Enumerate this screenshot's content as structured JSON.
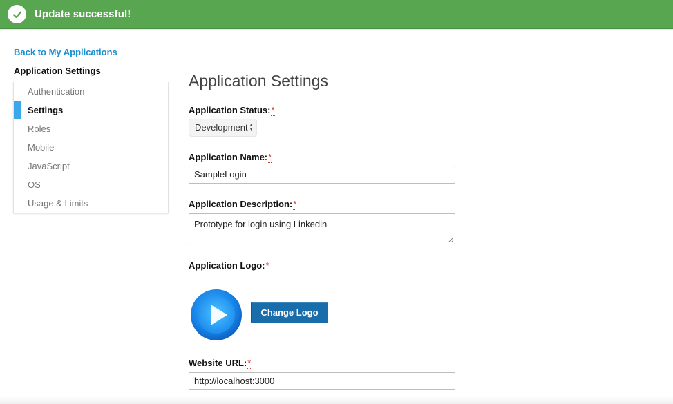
{
  "banner": {
    "message": "Update successful!",
    "icon": "check-icon",
    "color": "#58a650"
  },
  "sidebar": {
    "back_link": "Back to My Applications",
    "title": "Application Settings",
    "active_color": "#3ba9e8",
    "items": [
      {
        "label": "Authentication"
      },
      {
        "label": "Settings",
        "active": true
      },
      {
        "label": "Roles"
      },
      {
        "label": "Mobile"
      },
      {
        "label": "JavaScript"
      },
      {
        "label": "OS"
      },
      {
        "label": "Usage & Limits"
      }
    ]
  },
  "main": {
    "title": "Application Settings",
    "required_marker": "*",
    "status": {
      "label": "Application Status:",
      "value": "Development"
    },
    "name": {
      "label": "Application Name:",
      "value": "SampleLogin"
    },
    "description": {
      "label": "Application Description:",
      "value": "Prototype for login using Linkedin"
    },
    "logo": {
      "label": "Application Logo:",
      "icon": "play-logo-icon",
      "button": "Change Logo"
    },
    "website": {
      "label": "Website URL:",
      "value": "http://localhost:3000"
    }
  }
}
